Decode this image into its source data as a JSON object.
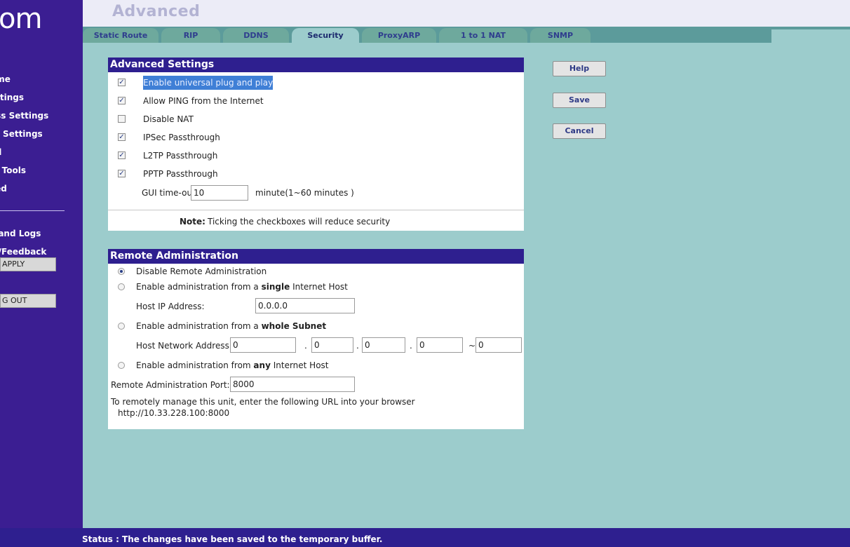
{
  "brand": "om",
  "page_title": "Advanced",
  "sidebar": {
    "items": [
      {
        "label": "ome"
      },
      {
        "label": "ettings"
      },
      {
        "label": "ess Settings"
      },
      {
        "label": "et Settings"
      },
      {
        "label": "all"
      },
      {
        "label": "m Tools"
      },
      {
        "label": "ced"
      }
    ],
    "items2": [
      {
        "label": "s and Logs"
      },
      {
        "label": "rt/Feedback"
      }
    ],
    "apply_label": "APPLY",
    "logout_label": "G OUT"
  },
  "tabs": [
    {
      "label": "Static Route",
      "active": false
    },
    {
      "label": "RIP",
      "active": false
    },
    {
      "label": "DDNS",
      "active": false
    },
    {
      "label": "Security",
      "active": true
    },
    {
      "label": "ProxyARP",
      "active": false
    },
    {
      "label": "1 to 1 NAT",
      "active": false
    },
    {
      "label": "SNMP",
      "active": false
    }
  ],
  "advanced": {
    "title": "Advanced Settings",
    "options": [
      {
        "label": "Enable universal plug and play",
        "checked": true
      },
      {
        "label": "Allow PING from the Internet",
        "checked": true
      },
      {
        "label": "Disable NAT",
        "checked": false
      },
      {
        "label": "IPSec Passthrough",
        "checked": true
      },
      {
        "label": "L2TP Passthrough",
        "checked": true
      },
      {
        "label": "PPTP Passthrough",
        "checked": true
      }
    ],
    "timeout_label": "GUI time-out",
    "timeout_value": "10",
    "timeout_unit": "minute(1~60 minutes )",
    "note_bold": "Note:",
    "note_text": "Ticking the checkboxes will reduce security"
  },
  "remote": {
    "title": "Remote Administration",
    "opt_disable": "Disable Remote Administration",
    "opt_single_pre": "Enable administration from a",
    "opt_single_bold": "single",
    "opt_single_post": "Internet Host",
    "host_ip_label": "Host IP Address:",
    "host_ip_value": "0.0.0.0",
    "opt_subnet_pre": "Enable administration from a",
    "opt_subnet_bold": "whole Subnet",
    "net_label": "Host Network Address:",
    "net_values": [
      "0",
      "0",
      "0",
      "0",
      "0"
    ],
    "dot": ".",
    "tilde": "~",
    "opt_any_pre": "Enable administration from",
    "opt_any_bold": "any",
    "opt_any_post": "Internet Host",
    "port_label": "Remote Administration Port:",
    "port_value": "8000",
    "url_line1": "To remotely manage this unit, enter the following URL into your browser",
    "url_line2": "http://10.33.228.100:8000"
  },
  "buttons": {
    "help": "Help",
    "save": "Save",
    "cancel": "Cancel"
  },
  "status": "Status : The changes have been saved to the temporary buffer.",
  "colors": {
    "sidebar": "#3b1e92",
    "header_bar": "#2e1f8f",
    "content_bg": "#9ccccc",
    "tab": "#6ea99d"
  }
}
